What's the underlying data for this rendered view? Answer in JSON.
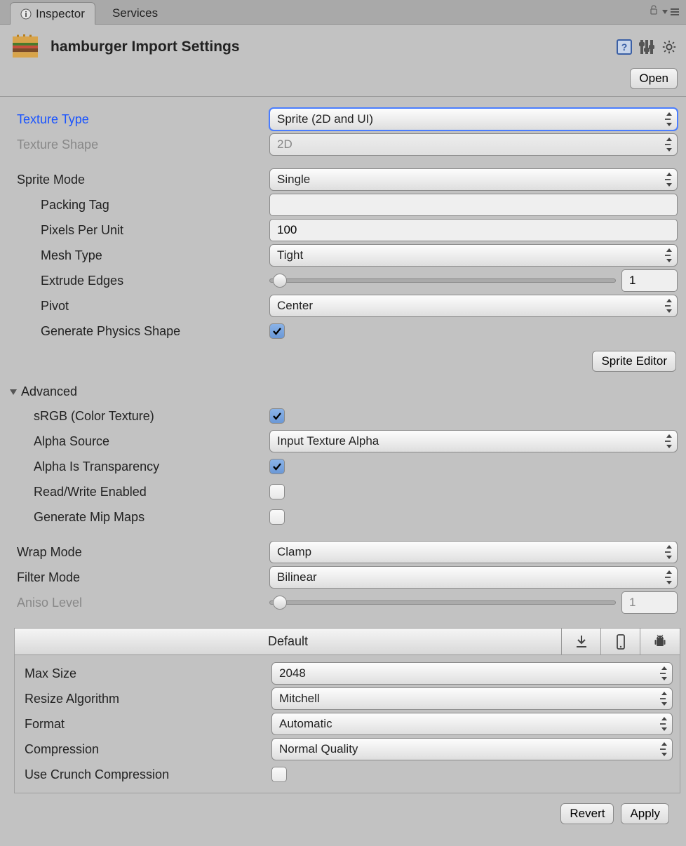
{
  "tabs": {
    "inspector": "Inspector",
    "services": "Services"
  },
  "header": {
    "title": "hamburger Import Settings",
    "open": "Open"
  },
  "fields": {
    "textureType": {
      "label": "Texture Type",
      "value": "Sprite (2D and UI)"
    },
    "textureShape": {
      "label": "Texture Shape",
      "value": "2D"
    },
    "spriteMode": {
      "label": "Sprite Mode",
      "value": "Single"
    },
    "packingTag": {
      "label": "Packing Tag",
      "value": ""
    },
    "pixelsPerUnit": {
      "label": "Pixels Per Unit",
      "value": "100"
    },
    "meshType": {
      "label": "Mesh Type",
      "value": "Tight"
    },
    "extrudeEdges": {
      "label": "Extrude Edges",
      "value": "1",
      "pct": 3
    },
    "pivot": {
      "label": "Pivot",
      "value": "Center"
    },
    "genPhysics": {
      "label": "Generate Physics Shape",
      "checked": true
    },
    "spriteEditor": "Sprite Editor",
    "advanced": "Advanced",
    "srgb": {
      "label": "sRGB (Color Texture)",
      "checked": true
    },
    "alphaSource": {
      "label": "Alpha Source",
      "value": "Input Texture Alpha"
    },
    "alphaTrans": {
      "label": "Alpha Is Transparency",
      "checked": true
    },
    "readWrite": {
      "label": "Read/Write Enabled",
      "checked": false
    },
    "genMips": {
      "label": "Generate Mip Maps",
      "checked": false
    },
    "wrapMode": {
      "label": "Wrap Mode",
      "value": "Clamp"
    },
    "filterMode": {
      "label": "Filter Mode",
      "value": "Bilinear"
    },
    "aniso": {
      "label": "Aniso Level",
      "value": "1",
      "pct": 3
    }
  },
  "platform": {
    "default": "Default",
    "maxSize": {
      "label": "Max Size",
      "value": "2048"
    },
    "resize": {
      "label": "Resize Algorithm",
      "value": "Mitchell"
    },
    "format": {
      "label": "Format",
      "value": "Automatic"
    },
    "compression": {
      "label": "Compression",
      "value": "Normal Quality"
    },
    "crunch": {
      "label": "Use Crunch Compression",
      "checked": false
    }
  },
  "footer": {
    "revert": "Revert",
    "apply": "Apply"
  }
}
